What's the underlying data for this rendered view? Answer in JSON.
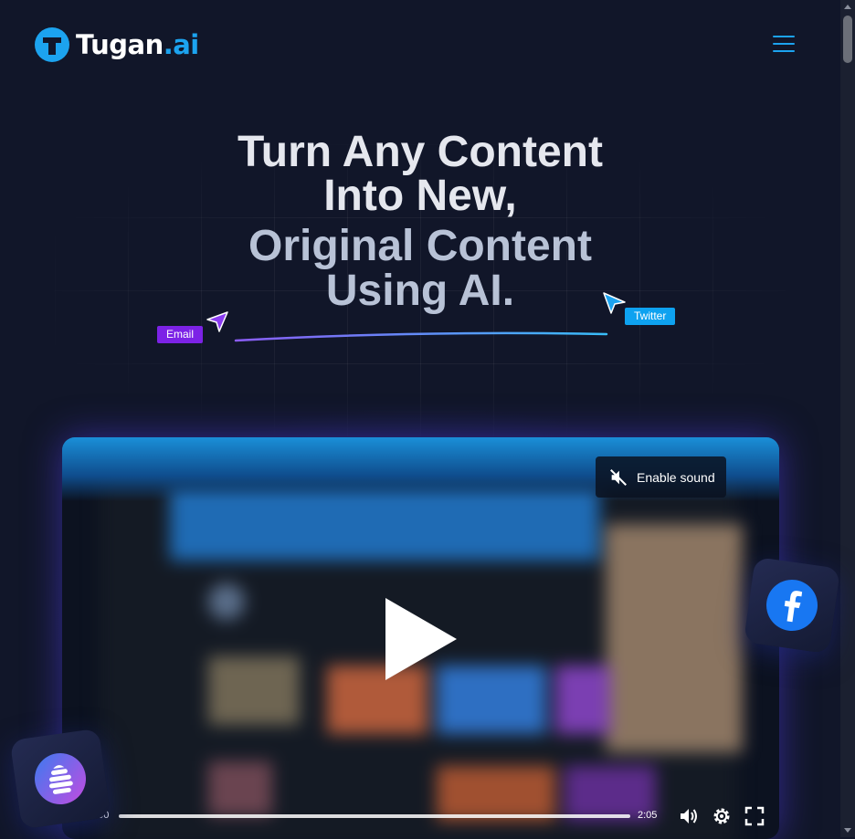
{
  "brand": {
    "name": "Tugan",
    "suffix": ".ai",
    "accent": "#1ca3ef"
  },
  "hero": {
    "line1": "Turn Any Content",
    "line2": "Into New,",
    "line3": "Original Content",
    "line4": "Using AI."
  },
  "tags": {
    "email": "Email",
    "twitter": "Twitter"
  },
  "video": {
    "sound_label": "Enable sound",
    "time_current": "0:00",
    "time_total": "2:05"
  },
  "icons": {
    "menu": "hamburger-icon",
    "sound": "muted-speaker-icon",
    "play": "play-icon",
    "volume": "volume-icon",
    "settings": "gear-icon",
    "fullscreen": "fullscreen-icon",
    "facebook": "facebook-icon",
    "hive": "beehive-icon"
  }
}
